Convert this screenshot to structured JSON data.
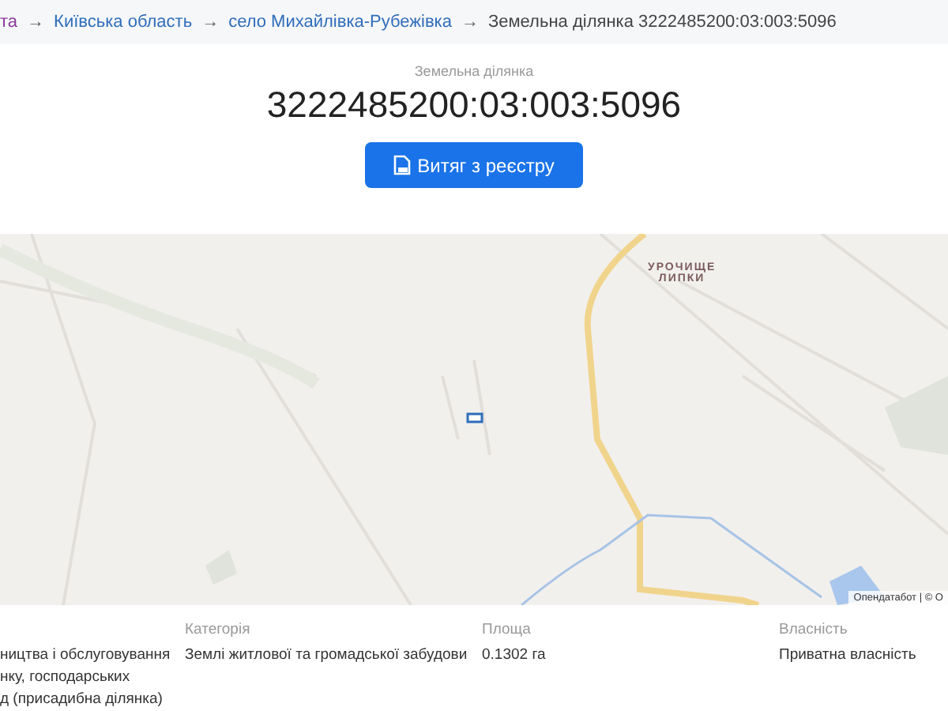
{
  "breadcrumbs": [
    {
      "label": "та",
      "visited": true
    },
    {
      "label": "Київська область",
      "visited": false
    },
    {
      "label": "село Михайлівка-Рубежівка",
      "visited": false
    },
    {
      "label": "Земельна ділянка 3222485200:03:003:5096",
      "current": true
    }
  ],
  "breadcrumb_separator": "→",
  "header": {
    "subtitle": "Земельна ділянка",
    "title": "3222485200:03:003:5096",
    "button": "Витяг з реєстру"
  },
  "map": {
    "place_label": "УРОЧИЩЕ\nЛИПКИ",
    "attribution": "Опендатабот | © О"
  },
  "details": [
    {
      "value": "ництва і обслуговування\nнку, господарських\nд (присадибна ділянка)"
    },
    {
      "label": "Категорія",
      "value": "Землі житлової та громадської забудови"
    },
    {
      "label": "Площа",
      "value": "0.1302 га"
    },
    {
      "label": "Власність",
      "value": "Приватна власність"
    }
  ]
}
